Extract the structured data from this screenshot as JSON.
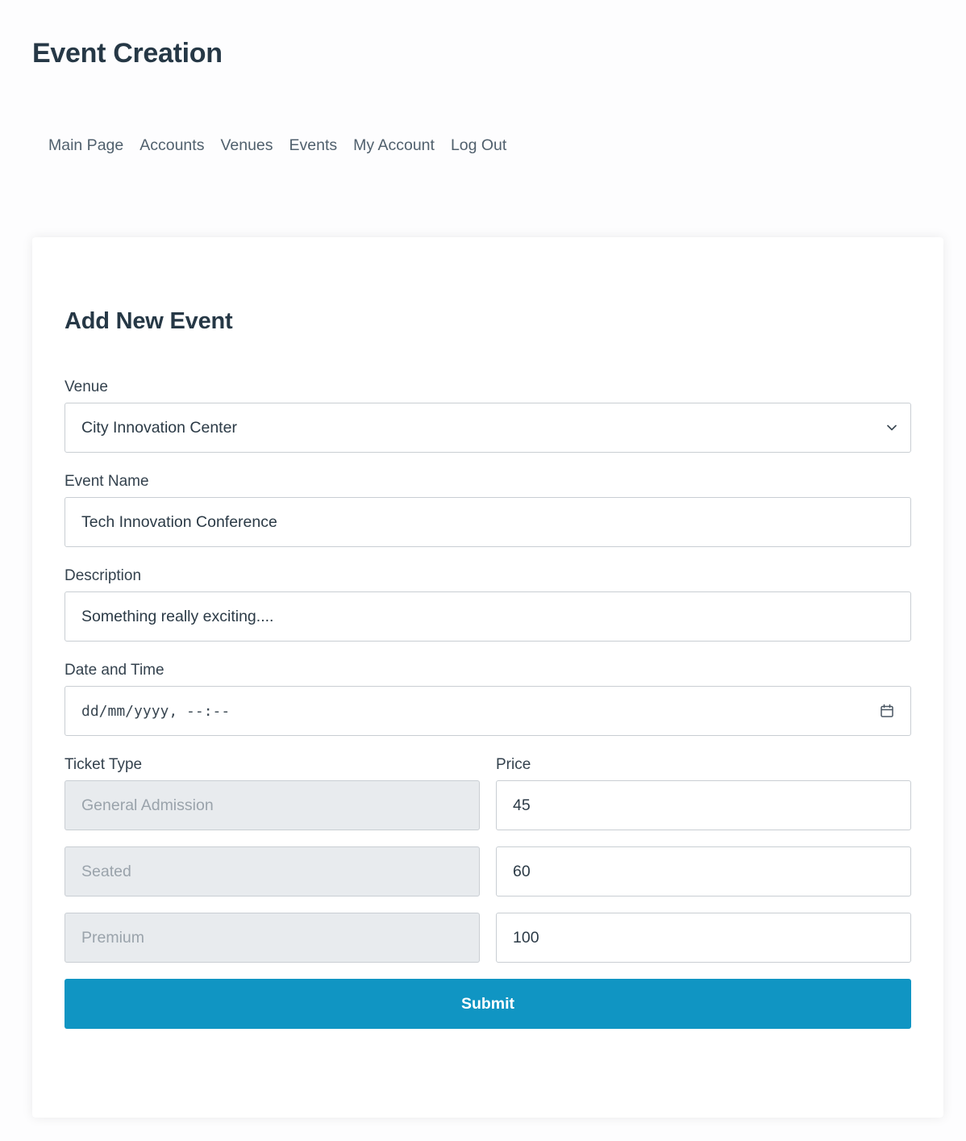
{
  "header": {
    "title": "Event Creation"
  },
  "nav": {
    "items": [
      "Main Page",
      "Accounts",
      "Venues",
      "Events",
      "My Account",
      "Log Out"
    ]
  },
  "form": {
    "title": "Add New Event",
    "venue_label": "Venue",
    "venue_value": "City Innovation Center",
    "venue_icon": "chevron-down-icon",
    "event_name_label": "Event Name",
    "event_name_value": "Tech Innovation Conference",
    "description_label": "Description",
    "description_value": "Something really exciting....",
    "datetime_label": "Date and Time",
    "datetime_placeholder": "dd/mm/yyyy, --:--",
    "datetime_icon": "calendar-icon",
    "ticket_type_label": "Ticket Type",
    "price_label": "Price",
    "tickets": [
      {
        "type": "General Admission",
        "price": "45"
      },
      {
        "type": "Seated",
        "price": "60"
      },
      {
        "type": "Premium",
        "price": "100"
      }
    ],
    "submit_label": "Submit"
  },
  "colors": {
    "accent": "#1095c3",
    "text": "#263846",
    "readonly_bg": "#e8ebee",
    "border": "#c9ced3"
  }
}
